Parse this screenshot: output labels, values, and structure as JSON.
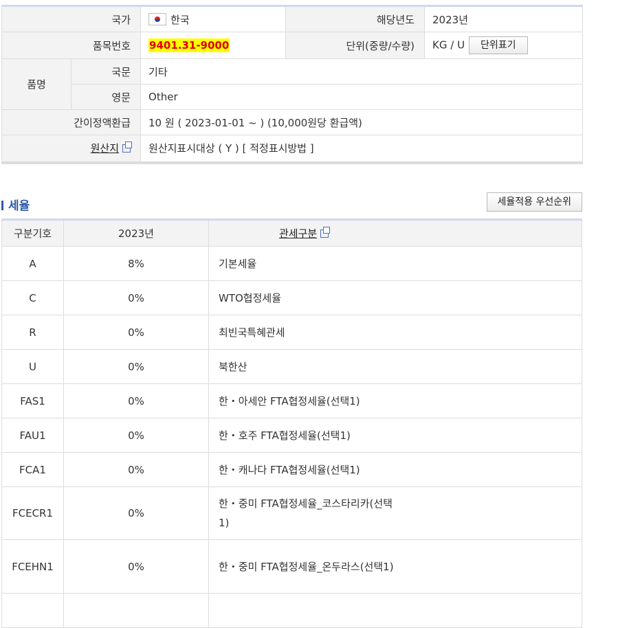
{
  "info": {
    "country_label": "국가",
    "country_value": "한국",
    "year_label": "해당년도",
    "year_value": "2023년",
    "hs_label": "품목번호",
    "hs_value": "9401.31-9000",
    "unit_label": "단위(중량/수량)",
    "unit_value": "KG / U",
    "unit_button": "단위표기",
    "name_label": "품명",
    "name_kr_label": "국문",
    "name_kr_value": "기타",
    "name_en_label": "영문",
    "name_en_value": "Other",
    "refund_label": "간이정액환급",
    "refund_value": "10 원 ( 2023-01-01 ~ ) (10,000원당 환급액)",
    "origin_label": "원산지",
    "origin_value": "원산지표시대상 ( Y ) [ 적정표시방법 ]"
  },
  "section": {
    "title": "세율",
    "priority_button": "세율적용 우선순위"
  },
  "rates": {
    "headers": [
      "구분기호",
      "2023년",
      "관세구분"
    ],
    "rows": [
      {
        "code": "A",
        "rate": "8%",
        "desc": "기본세율"
      },
      {
        "code": "C",
        "rate": "0%",
        "desc": "WTO협정세율"
      },
      {
        "code": "R",
        "rate": "0%",
        "desc": "최빈국특혜관세"
      },
      {
        "code": "U",
        "rate": "0%",
        "desc": "북한산"
      },
      {
        "code": "FAS1",
        "rate": "0%",
        "desc": "한・아세안 FTA협정세율(선택1)"
      },
      {
        "code": "FAU1",
        "rate": "0%",
        "desc": "한・호주 FTA협정세율(선택1)"
      },
      {
        "code": "FCA1",
        "rate": "0%",
        "desc": "한・캐나다 FTA협정세율(선택1)"
      },
      {
        "code": "FCECR1",
        "rate": "0%",
        "desc": "한・중미 FTA협정세율_코스타리카(선택1)"
      },
      {
        "code": "FCEHN1",
        "rate": "0%",
        "desc": "한・중미 FTA협정세율_온두라스(선택1)"
      }
    ]
  }
}
